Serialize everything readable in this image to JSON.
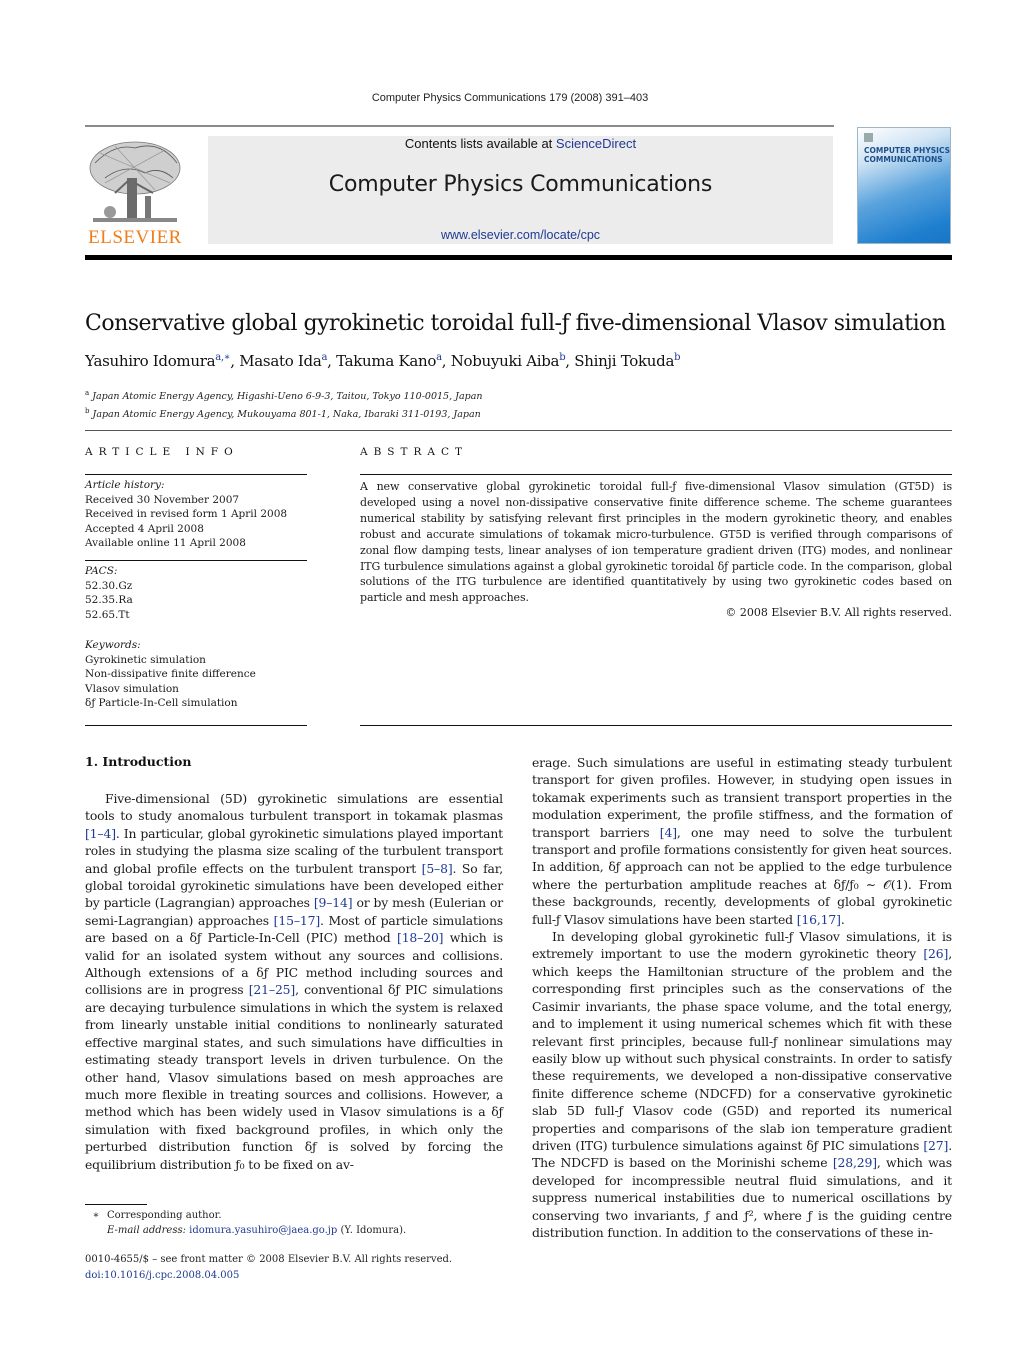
{
  "header": {
    "running_head": "Computer Physics Communications 179 (2008) 391–403",
    "contents_prefix": "Contents lists available at ",
    "contents_link": "ScienceDirect",
    "journal_name": "Computer Physics Communications",
    "journal_url": "www.elsevier.com/locate/cpc",
    "publisher_logo": "ELSEVIER",
    "cover_title_line1": "COMPUTER PHYSICS",
    "cover_title_line2": "COMMUNICATIONS",
    "colors": {
      "publisher_orange": "#f07d1a",
      "link_blue": "#1f3a93",
      "masthead_gray": "#ececec"
    }
  },
  "article": {
    "title": "Conservative global gyrokinetic toroidal full-ƒ five-dimensional Vlasov simulation",
    "authors": [
      {
        "name": "Yasuhiro Idomura",
        "sup": "a,∗"
      },
      {
        "name": "Masato Ida",
        "sup": "a"
      },
      {
        "name": "Takuma Kano",
        "sup": "a"
      },
      {
        "name": "Nobuyuki Aiba",
        "sup": "b"
      },
      {
        "name": "Shinji Tokuda",
        "sup": "b"
      }
    ],
    "affiliations": [
      {
        "mark": "a",
        "text": "Japan Atomic Energy Agency, Higashi-Ueno 6-9-3, Taitou, Tokyo 110-0015, Japan"
      },
      {
        "mark": "b",
        "text": "Japan Atomic Energy Agency, Mukouyama 801-1, Naka, Ibaraki 311-0193, Japan"
      }
    ]
  },
  "article_info": {
    "heading": "ARTICLE INFO",
    "history_label": "Article history:",
    "history": [
      "Received 30 November 2007",
      "Received in revised form 1 April 2008",
      "Accepted 4 April 2008",
      "Available online 11 April 2008"
    ],
    "pacs_label": "PACS:",
    "pacs": [
      "52.30.Gz",
      "52.35.Ra",
      "52.65.Tt"
    ],
    "keywords_label": "Keywords:",
    "keywords": [
      "Gyrokinetic simulation",
      "Non-dissipative finite difference",
      "Vlasov simulation",
      "δƒ Particle-In-Cell simulation"
    ]
  },
  "abstract": {
    "heading": "ABSTRACT",
    "text": "A new conservative global gyrokinetic toroidal full-ƒ five-dimensional Vlasov simulation (GT5D) is developed using a novel non-dissipative conservative finite difference scheme. The scheme guarantees numerical stability by satisfying relevant first principles in the modern gyrokinetic theory, and enables robust and accurate simulations of tokamak micro-turbulence. GT5D is verified through comparisons of zonal flow damping tests, linear analyses of ion temperature gradient driven (ITG) modes, and nonlinear ITG turbulence simulations against a global gyrokinetic toroidal δƒ particle code. In the comparison, global solutions of the ITG turbulence are identified quantitatively by using two gyrokinetic codes based on particle and mesh approaches.",
    "copyright": "© 2008 Elsevier B.V. All rights reserved."
  },
  "body": {
    "section_heading": "1. Introduction",
    "left_paragraphs": [
      [
        {
          "t": "Five-dimensional (5D) gyrokinetic simulations are essential tools to study anomalous turbulent transport in tokamak plasmas "
        },
        {
          "ref": "[1–4]"
        },
        {
          "t": ". In particular, global gyrokinetic simulations played important roles in studying the plasma size scaling of the turbulent transport and global profile effects on the turbulent transport "
        },
        {
          "ref": "[5–8]"
        },
        {
          "t": ". So far, global toroidal gyrokinetic simulations have been developed either by particle (Lagrangian) approaches "
        },
        {
          "ref": "[9–14]"
        },
        {
          "t": " or by mesh (Eulerian or semi-Lagrangian) approaches "
        },
        {
          "ref": "[15–17]"
        },
        {
          "t": ". Most of particle simulations are based on a δƒ Particle-In-Cell (PIC) method "
        },
        {
          "ref": "[18–20]"
        },
        {
          "t": " which is valid for an isolated system without any sources and collisions. Although extensions of a δƒ PIC method including sources and collisions are in progress "
        },
        {
          "ref": "[21–25]"
        },
        {
          "t": ", conventional δƒ PIC simulations are decaying turbulence simulations in which the system is relaxed from linearly unstable initial conditions to nonlinearly saturated effective marginal states, and such simulations have difficulties in estimating steady transport levels in driven turbulence. On the other hand, Vlasov simulations based on mesh approaches are much more flexible in treating sources and collisions. However, a method which has been widely used in Vlasov simulations is a δƒ simulation with fixed background profiles, in which only the perturbed distribution function δƒ is solved by forcing the equilibrium distribution ƒ₀ to be fixed on av-"
        }
      ]
    ],
    "right_paragraphs": [
      [
        {
          "t": "erage. Such simulations are useful in estimating steady turbulent transport for given profiles. However, in studying open issues in tokamak experiments such as transient transport properties in the modulation experiment, the profile stiffness, and the formation of transport barriers "
        },
        {
          "ref": "[4]"
        },
        {
          "t": ", one may need to solve the turbulent transport and profile formations consistently for given heat sources. In addition, δƒ approach can not be applied to the edge turbulence where the perturbation amplitude reaches at δƒ/ƒ₀ ∼ 𝒪(1). From these backgrounds, recently, developments of global gyrokinetic full-ƒ Vlasov simulations have been started "
        },
        {
          "ref": "[16,17]"
        },
        {
          "t": "."
        }
      ],
      [
        {
          "t": "In developing global gyrokinetic full-ƒ Vlasov simulations, it is extremely important to use the modern gyrokinetic theory "
        },
        {
          "ref": "[26]"
        },
        {
          "t": ", which keeps the Hamiltonian structure of the problem and the corresponding first principles such as the conservations of the Casimir invariants, the phase space volume, and the total energy, and to implement it using numerical schemes which fit with these relevant first principles, because full-ƒ nonlinear simulations may easily blow up without such physical constraints. In order to satisfy these requirements, we developed a non-dissipative conservative finite difference scheme (NDCFD) for a conservative gyrokinetic slab 5D full-ƒ Vlasov code (G5D) and reported its numerical properties and comparisons of the slab ion temperature gradient driven (ITG) turbulence simulations against δƒ PIC simulations "
        },
        {
          "ref": "[27]"
        },
        {
          "t": ". The NDCFD is based on the Morinishi scheme "
        },
        {
          "ref": "[28,29]"
        },
        {
          "t": ", which was developed for incompressible neutral fluid simulations, and it suppress numerical instabilities due to numerical oscillations by conserving two invariants, ƒ and ƒ², where ƒ is the guiding centre distribution function. In addition to the conservations of these in-"
        }
      ]
    ]
  },
  "footnotes": {
    "star": "∗",
    "corresponding": "Corresponding author.",
    "email_label": "E-mail address:",
    "email": "idomura.yasuhiro@jaea.go.jp",
    "email_suffix": " (Y. Idomura).",
    "issn_line": "0010-4655/$ – see front matter  © 2008 Elsevier B.V. All rights reserved.",
    "doi": "doi:10.1016/j.cpc.2008.04.005"
  }
}
